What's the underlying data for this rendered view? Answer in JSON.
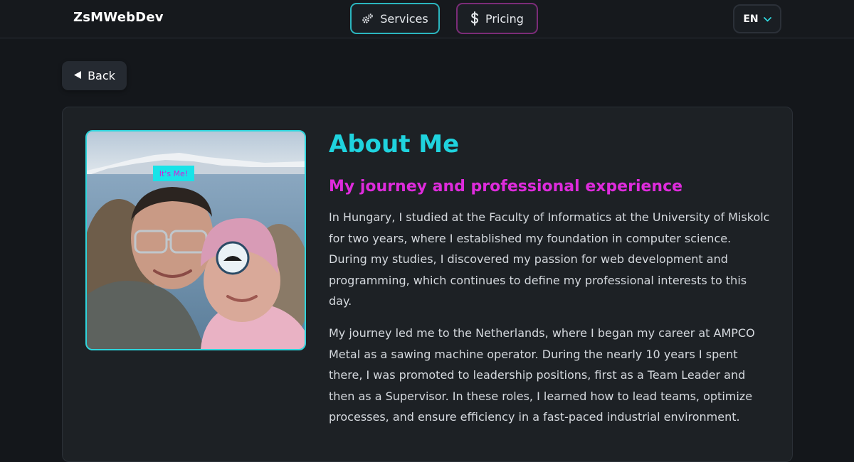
{
  "header": {
    "brand": "ZsMWebDev",
    "nav": {
      "services_label": "Services",
      "pricing_label": "Pricing"
    },
    "language": "EN"
  },
  "back_label": "Back",
  "about": {
    "title": "About Me",
    "subtitle": "My journey and professional experience",
    "photo_tag": "It's Me!",
    "paragraphs": [
      "In Hungary, I studied at the Faculty of Informatics at the University of Miskolc for two years, where I established my foundation in computer science. During my studies, I discovered my passion for web development and programming, which continues to define my professional interests to this day.",
      "My journey led me to the Netherlands, where I began my career at AMPCO Metal as a sawing machine operator. During the nearly 10 years I spent there, I was promoted to leadership positions, first as a Team Leader and then as a Supervisor. In these roles, I learned how to lead teams, optimize processes, and ensure efficiency in a fast-paced industrial environment."
    ]
  },
  "colors": {
    "accent_cyan": "#1fd3de",
    "accent_magenta": "#de2bdc",
    "background": "#14171b",
    "card": "#1d2125"
  },
  "icons": {
    "services": "gears-icon",
    "pricing": "dollar-icon",
    "language_dropdown": "chevron-down-icon",
    "back": "triangle-left-icon"
  }
}
